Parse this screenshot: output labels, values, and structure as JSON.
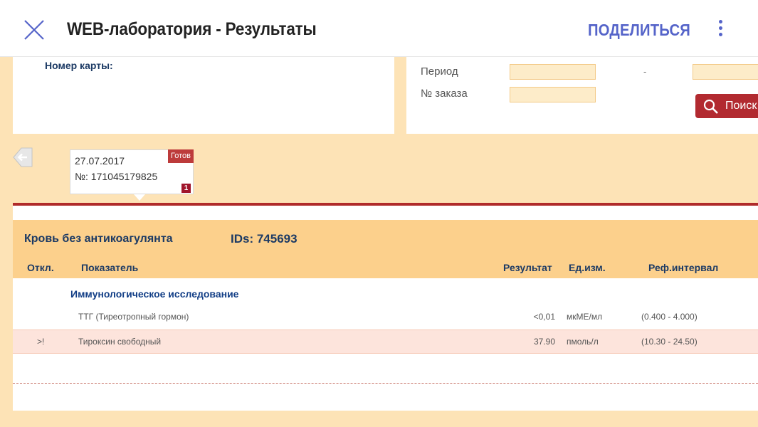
{
  "appbar": {
    "title": "WEB-лаборатория - Результаты",
    "share_label": "ПОДЕЛИТЬСЯ",
    "accent_color": "#5564c9",
    "close_icon": "close-icon",
    "more_icon": "more-vertical-icon"
  },
  "filters": {
    "card_label": "Номер карты:",
    "period_label": "Период",
    "period_separator": "-",
    "order_label": "№ заказа",
    "search_label": "Поиск"
  },
  "orders": {
    "back_icon": "back-arrow-icon",
    "items": [
      {
        "date": "27.07.2017",
        "number": "№: 171045179825",
        "status": "Готов",
        "count": "1"
      }
    ]
  },
  "results": {
    "specimen": "Кровь без антикоагулянта",
    "ids": "IDs: 745693",
    "columns": {
      "deviation": "Откл.",
      "indicator": "Показатель",
      "result": "Результат",
      "unit": "Ед.изм.",
      "ref": "Реф.интервал"
    },
    "group_title": "Иммунологическое исследование",
    "rows": [
      {
        "flag": "",
        "name": "ТТГ (Тиреотропный гормон)",
        "result": "<0,01",
        "unit": "мкМЕ/мл",
        "ref": "(0.400 - 4.000)"
      },
      {
        "flag": ">!",
        "name": "Тироксин свободный",
        "result": "37.90",
        "unit": "пмоль/л",
        "ref": "(10.30 - 24.50)"
      }
    ]
  },
  "colors": {
    "background": "#fde3b6",
    "header_band": "#fcd08c",
    "brand_red": "#b02b2b",
    "flag_row": "#fde4dc"
  }
}
